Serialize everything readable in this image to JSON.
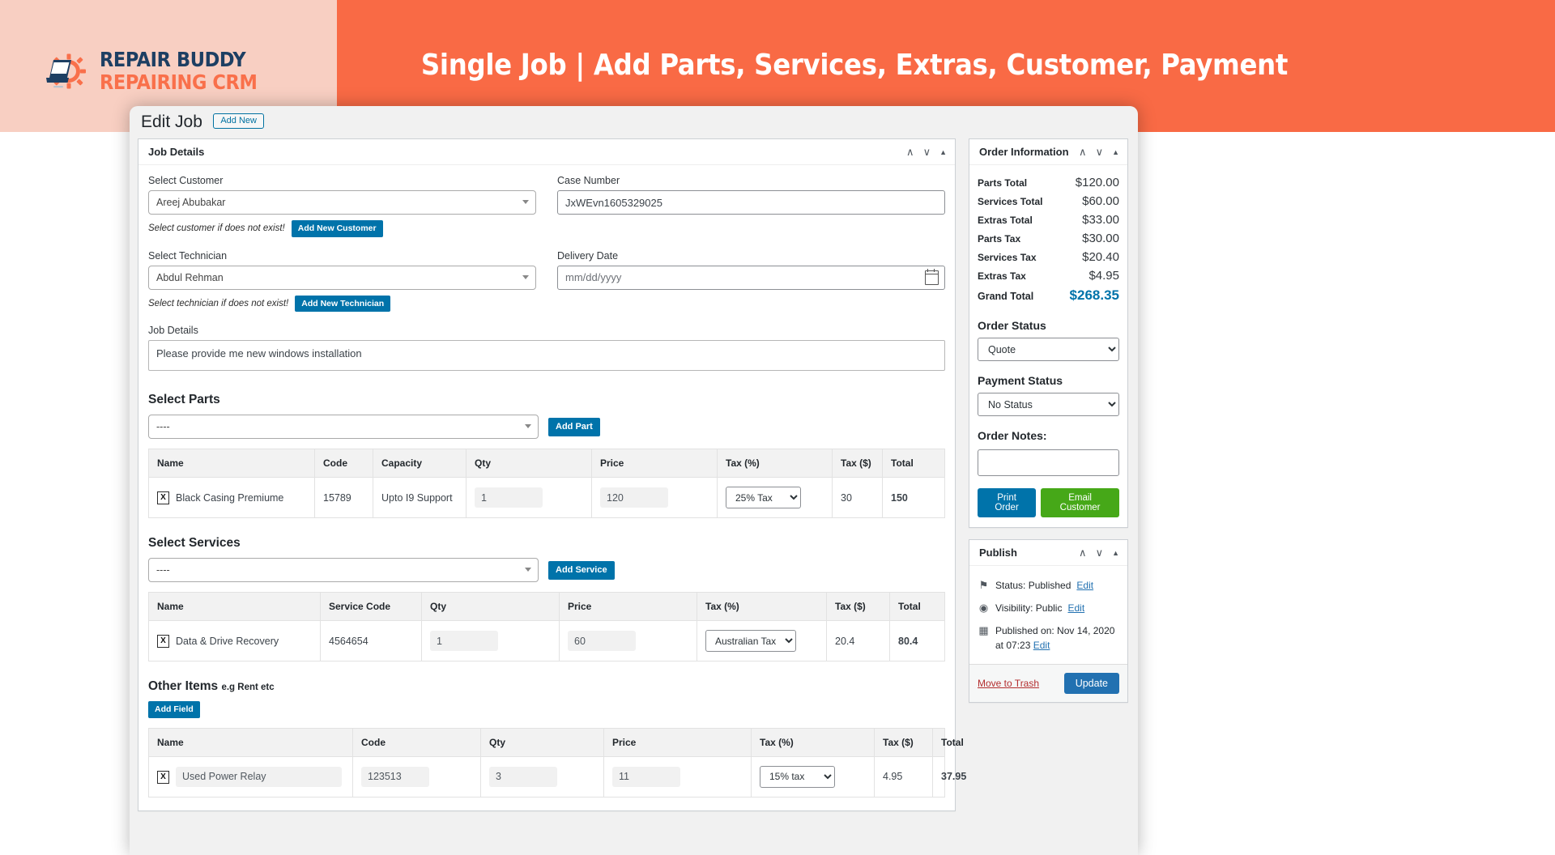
{
  "banner": {
    "title": "Single Job | Add Parts, Services, Extras, Customer, Payment",
    "logo_line1": "REPAIR BUDDY",
    "logo_line2": "REPAIRING CRM",
    "bg_left": "#f8cfc2",
    "bg_right": "#f96a45"
  },
  "topbar": {
    "heading": "Edit Job",
    "add_new_label": "Add New"
  },
  "job_details": {
    "panel_title": "Job Details",
    "customer_label": "Select Customer",
    "customer_value": "Areej Abubakar",
    "customer_hint": "Select customer if does not exist!",
    "customer_button": "Add New Customer",
    "case_number_label": "Case Number",
    "case_number_value": "JxWEvn1605329025",
    "technician_label": "Select Technician",
    "technician_value": "Abdul Rehman",
    "technician_hint": "Select technician if does not exist!",
    "technician_button": "Add New Technician",
    "delivery_date_label": "Delivery Date",
    "delivery_date_placeholder": "mm/dd/yyyy",
    "job_details_label": "Job Details",
    "job_details_value": "Please provide me new windows installation"
  },
  "parts": {
    "section_title": "Select Parts",
    "picker_value": "----",
    "add_button": "Add Part",
    "columns": [
      "Name",
      "Code",
      "Capacity",
      "Qty",
      "Price",
      "Tax (%)",
      "Tax ($)",
      "Total"
    ],
    "rows": [
      {
        "remove": "X",
        "name": "Black Casing Premiume",
        "code": "15789",
        "capacity": "Upto I9 Support",
        "qty": "1",
        "price": "120",
        "tax_percent": "25% Tax",
        "tax_dollar": "30",
        "total": "150"
      }
    ]
  },
  "services": {
    "section_title": "Select Services",
    "picker_value": "----",
    "add_button": "Add Service",
    "columns": [
      "Name",
      "Service Code",
      "Qty",
      "Price",
      "Tax (%)",
      "Tax ($)",
      "Total"
    ],
    "rows": [
      {
        "remove": "X",
        "name": "Data & Drive Recovery",
        "code": "4564654",
        "qty": "1",
        "price": "60",
        "tax_percent": "Australian Tax",
        "tax_dollar": "20.4",
        "total": "80.4"
      }
    ]
  },
  "other_items": {
    "section_title": "Other Items",
    "section_subtitle": "e.g Rent etc",
    "add_button": "Add Field",
    "columns": [
      "Name",
      "Code",
      "Qty",
      "Price",
      "Tax (%)",
      "Tax ($)",
      "Total"
    ],
    "rows": [
      {
        "remove": "X",
        "name": "Used Power Relay",
        "code": "123513",
        "qty": "3",
        "price": "11",
        "tax_percent": "15% tax",
        "tax_dollar": "4.95",
        "total": "37.95"
      }
    ]
  },
  "order_information": {
    "panel_title": "Order Information",
    "totals": [
      {
        "label": "Parts Total",
        "value": "$120.00"
      },
      {
        "label": "Services Total",
        "value": "$60.00"
      },
      {
        "label": "Extras Total",
        "value": "$33.00"
      },
      {
        "label": "Parts Tax",
        "value": "$30.00"
      },
      {
        "label": "Services Tax",
        "value": "$20.40"
      },
      {
        "label": "Extras Tax",
        "value": "$4.95"
      }
    ],
    "grand_total_label": "Grand Total",
    "grand_total_value": "$268.35",
    "grand_total_color": "#0073aa",
    "order_status_label": "Order Status",
    "order_status_value": "Quote",
    "payment_status_label": "Payment Status",
    "payment_status_value": "No Status",
    "order_notes_label": "Order Notes:",
    "order_notes_value": "",
    "print_button": "Print Order",
    "email_button": "Email Customer",
    "email_button_color": "#46a818"
  },
  "publish": {
    "panel_title": "Publish",
    "status_text": "Status: Published",
    "status_edit": "Edit",
    "visibility_text": "Visibility: Public",
    "visibility_edit": "Edit",
    "published_text": "Published on: Nov 14, 2020 at 07:23",
    "published_edit": "Edit",
    "trash_label": "Move to Trash",
    "update_label": "Update"
  },
  "icons": {
    "chevron_up": "∧",
    "chevron_down": "∨",
    "triangle_up": "▲",
    "pin_icon": "⚑",
    "eye_icon": "◉",
    "calendar_icon": "▦"
  }
}
